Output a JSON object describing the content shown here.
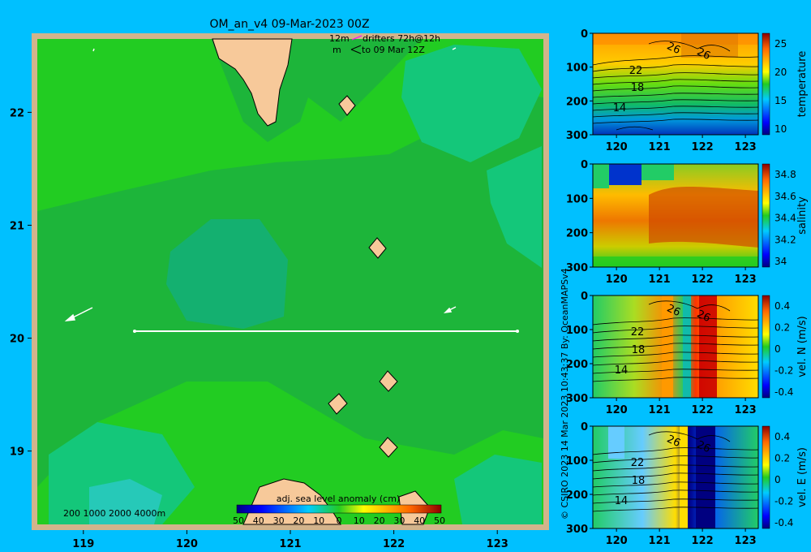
{
  "title": "OM_an_v4  09-Mar-2023 00Z",
  "drifter_legend": {
    "line1_left": "12m",
    "line1_right": "drifters 72h@12h",
    "line2_left": "m",
    "line2_right": "to 09 Mar 12Z"
  },
  "bathy_legend": "200  1000  2000  4000m",
  "sla_colorbar": {
    "label": "adj. sea level anomaly (cm)",
    "ticks": [
      "50",
      "40",
      "30",
      "20",
      "10",
      "0",
      "10",
      "20",
      "30",
      "40",
      "50"
    ]
  },
  "credit": "© CSIRO 2023   14 Mar 2023 10:43:37 By: OceanMAPSv4",
  "colors": {
    "background": "#00c0ff",
    "land": "#f7c99a",
    "land_frame": "#d2b48c",
    "ocean_main": "#1db53a",
    "ocean_bright": "#22cc22",
    "ocean_teal": "#14c77a"
  },
  "chart_data": [
    {
      "type": "heatmap",
      "name": "map",
      "xlim": [
        118.5,
        123.5
      ],
      "ylim": [
        18.3,
        22.7
      ],
      "xticks": [
        "119",
        "120",
        "121",
        "122",
        "123"
      ],
      "yticks": [
        "19",
        "20",
        "21",
        "22"
      ],
      "section_line": {
        "lon": [
          119.5,
          123.2
        ],
        "lat": [
          20.0,
          20.0
        ]
      }
    },
    {
      "type": "heatmap",
      "name": "temperature",
      "ylabel": "temperature",
      "yticks": [
        "0",
        "100",
        "200",
        "300"
      ],
      "xticks": [
        "120",
        "121",
        "122",
        "123"
      ],
      "cbar_ticks": [
        "25",
        "20",
        "15",
        "10"
      ],
      "contour_labels": [
        "26",
        "26",
        "22",
        "18",
        "14"
      ]
    },
    {
      "type": "heatmap",
      "name": "salinity",
      "ylabel": "salinity",
      "yticks": [
        "0",
        "100",
        "200",
        "300"
      ],
      "xticks": [
        "120",
        "121",
        "122",
        "123"
      ],
      "cbar_ticks": [
        "34.8",
        "34.6",
        "34.4",
        "34.2",
        "34"
      ]
    },
    {
      "type": "heatmap",
      "name": "vel_n",
      "ylabel": "vel. N (m/s)",
      "yticks": [
        "0",
        "100",
        "200",
        "300"
      ],
      "xticks": [
        "120",
        "121",
        "122",
        "123"
      ],
      "cbar_ticks": [
        "0.4",
        "0.2",
        "0",
        "-0.2",
        "-0.4"
      ],
      "contour_labels": [
        "26",
        "26",
        "22",
        "18",
        "14"
      ]
    },
    {
      "type": "heatmap",
      "name": "vel_e",
      "ylabel": "vel. E (m/s)",
      "yticks": [
        "0",
        "100",
        "200",
        "300"
      ],
      "xticks": [
        "120",
        "121",
        "122",
        "123"
      ],
      "cbar_ticks": [
        "0.4",
        "0.2",
        "0",
        "-0.2",
        "-0.4"
      ],
      "contour_labels": [
        "26",
        "26",
        "22",
        "18",
        "14"
      ]
    }
  ]
}
